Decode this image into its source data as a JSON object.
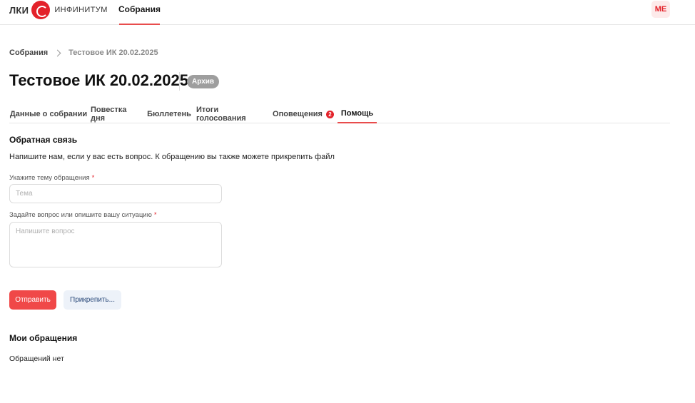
{
  "header": {
    "logo_prefix": "ЛКИ",
    "logo_brand": "ИНФИНИТУМ",
    "nav_item": "Собрания",
    "avatar_initials": "МЕ"
  },
  "breadcrumb": {
    "root": "Собрания",
    "current": "Тестовое ИК 20.02.2025"
  },
  "page": {
    "title": "Тестовое ИК 20.02.2025",
    "status_badge": "Архив"
  },
  "tabs": [
    {
      "label": "Данные о собрании"
    },
    {
      "label": "Повестка дня"
    },
    {
      "label": "Бюллетень"
    },
    {
      "label": "Итоги голосования"
    },
    {
      "label": "Оповещения",
      "badge": "2"
    },
    {
      "label": "Помощь",
      "active": true
    }
  ],
  "feedback": {
    "title": "Обратная связь",
    "description": "Напишите нам, если у вас есть вопрос. К обращению вы также можете прикрепить файл",
    "subject_label": "Укажите тему обращения",
    "subject_placeholder": "Тема",
    "subject_value": "",
    "question_label": "Задайте вопрос или опишите вашу ситуацию",
    "question_placeholder": "Напишите вопрос",
    "question_value": "",
    "required_mark": "*",
    "submit_label": "Отправить",
    "attach_label": "Прикрепить..."
  },
  "my_requests": {
    "title": "Мои обращения",
    "empty_text": "Обращений нет"
  },
  "colors": {
    "accent": "#e84c4c",
    "brand_red": "#e3222a",
    "badge_gray": "#9e9e9e",
    "secondary_button_bg": "#edf2f9"
  },
  "icons": [
    "logo-mark-icon",
    "chevron-right-icon"
  ]
}
